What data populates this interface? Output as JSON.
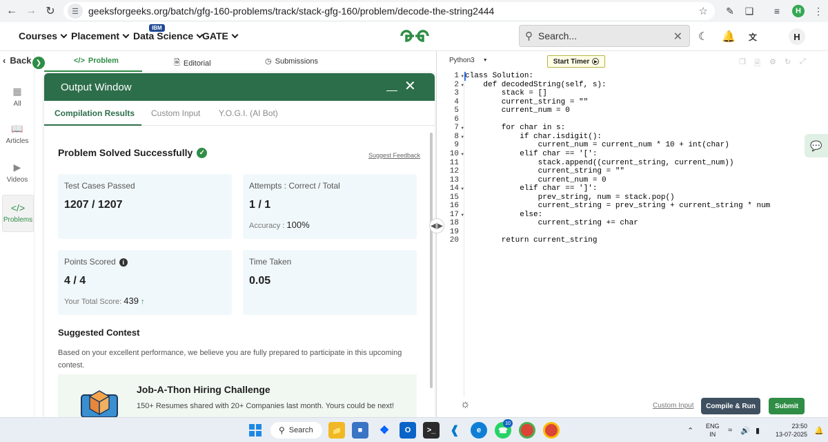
{
  "browser": {
    "url": "geeksforgeeks.org/batch/gfg-160-problems/track/stack-gfg-160/problem/decode-the-string2444",
    "profile_initial": "H"
  },
  "header": {
    "menu": [
      {
        "label": "Courses"
      },
      {
        "label": "Placement"
      },
      {
        "label": "Data Science"
      },
      {
        "label": "GATE"
      }
    ],
    "ibm_badge": "IBM",
    "logo_text": "GfG",
    "search_placeholder": "Search...",
    "user_initial": "H"
  },
  "sidebar": {
    "back_label": "Back",
    "items": [
      {
        "label": "All",
        "icon": "grid-icon"
      },
      {
        "label": "Articles",
        "icon": "book-icon"
      },
      {
        "label": "Videos",
        "icon": "video-icon"
      },
      {
        "label": "Problems",
        "icon": "code-icon"
      }
    ]
  },
  "problem_tabs": [
    {
      "label": "Problem"
    },
    {
      "label": "Editorial"
    },
    {
      "label": "Submissions"
    }
  ],
  "output_window": {
    "title": "Output Window",
    "tabs": [
      "Compilation Results",
      "Custom Input",
      "Y.O.G.I. (AI Bot)"
    ],
    "status": "Problem Solved Successfully",
    "suggest_feedback": "Suggest Feedback",
    "cards": {
      "test_cases_label": "Test Cases Passed",
      "test_cases_value": "1207 / 1207",
      "attempts_label": "Attempts : Correct / Total",
      "attempts_value": "1 / 1",
      "accuracy_label": "Accuracy :",
      "accuracy_value": "100%",
      "points_label": "Points Scored",
      "points_value": "4 / 4",
      "total_score_label": "Your Total Score:",
      "total_score_value": "439",
      "time_label": "Time Taken",
      "time_value": "0.05"
    },
    "contest": {
      "section_title": "Suggested Contest",
      "description": "Based on your excellent performance, we believe you are fully prepared to participate in this upcoming contest.",
      "name": "Job-A-Thon Hiring Challenge",
      "subtitle": "150+ Resumes shared with 20+ Companies last month. Yours could be next!"
    }
  },
  "editor": {
    "language": "Python3",
    "start_timer": "Start Timer",
    "lines": [
      "class Solution:",
      "    def decodedString(self, s):",
      "        stack = []",
      "        current_string = \"\"",
      "        current_num = 0",
      "",
      "        for char in s:",
      "            if char.isdigit():",
      "                current_num = current_num * 10 + int(char)",
      "            elif char == '[':",
      "                stack.append((current_string, current_num))",
      "                current_string = \"\"",
      "                current_num = 0",
      "            elif char == ']':",
      "                prev_string, num = stack.pop()",
      "                current_string = prev_string + current_string * num",
      "            else:",
      "                current_string += char",
      "",
      "        return current_string"
    ],
    "line_numbers": [
      "1",
      "2",
      "3",
      "4",
      "5",
      "6",
      "7",
      "8",
      "9",
      "10",
      "11",
      "12",
      "13",
      "14",
      "15",
      "16",
      "17",
      "18",
      "19",
      "20"
    ],
    "fold_lines": [
      1,
      2,
      7,
      8,
      10,
      14,
      17
    ],
    "custom_input": "Custom Input",
    "compile_run": "Compile & Run",
    "submit": "Submit"
  },
  "taskbar": {
    "search": "Search",
    "whatsapp_badge": "10",
    "lang_line1": "ENG",
    "lang_line2": "IN",
    "time": "23:50",
    "date": "13-07-2025"
  },
  "colors": {
    "gfg_green": "#2f8d46",
    "output_header": "#2c6e4a",
    "card_bg": "#f1f8fb",
    "compile_btn": "#3f5060"
  }
}
